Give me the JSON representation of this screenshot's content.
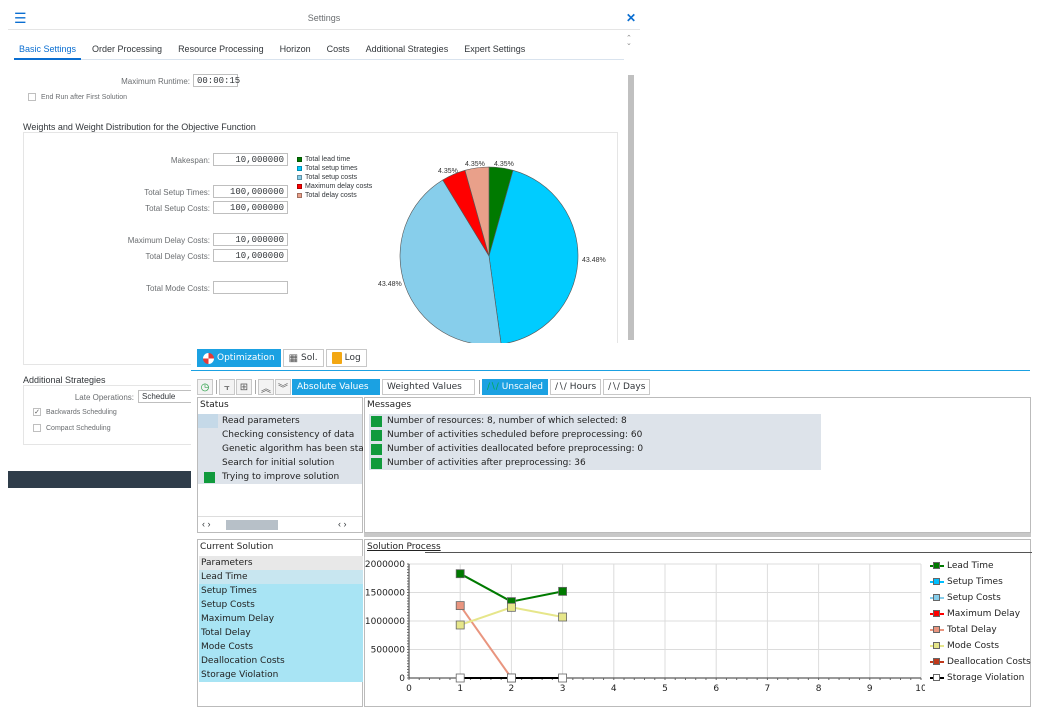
{
  "settings": {
    "title": "Settings",
    "menu_icon": "☰",
    "close_icon": "✕",
    "tabs": [
      {
        "label": "Basic Settings",
        "active": true
      },
      {
        "label": "Order Processing"
      },
      {
        "label": "Resource Processing"
      },
      {
        "label": "Horizon"
      },
      {
        "label": "Costs"
      },
      {
        "label": "Additional Strategies"
      },
      {
        "label": "Expert Settings"
      }
    ],
    "max_runtime_label": "Maximum Runtime:",
    "max_runtime_value": "00:00:15",
    "end_run_label": "End Run after First Solution",
    "end_run_checked": false,
    "weights": {
      "title": "Weights and Weight Distribution for the Objective Function",
      "fields": [
        {
          "label": "Makespan:",
          "value": "10,000000"
        },
        {
          "label": "Total Setup Times:",
          "value": "100,000000"
        },
        {
          "label": "Total Setup Costs:",
          "value": "100,000000"
        },
        {
          "label": "Maximum Delay Costs:",
          "value": "10,000000"
        },
        {
          "label": "Total Delay Costs:",
          "value": "10,000000"
        },
        {
          "label": "Total Mode Costs:",
          "value": ""
        }
      ]
    },
    "additional": {
      "title": "Additional Strategies",
      "late_ops_label": "Late Operations:",
      "late_ops_value": "Schedule",
      "backwards_label": "Backwards Scheduling",
      "backwards_checked": true,
      "compact_label": "Compact Scheduling",
      "compact_checked": false
    }
  },
  "pie_chart": {
    "type": "pie",
    "legend": [
      {
        "label": "Total lead time",
        "color": "#007a00"
      },
      {
        "label": "Total setup times",
        "color": "#00ccff"
      },
      {
        "label": "Total setup costs",
        "color": "#87ceeb"
      },
      {
        "label": "Maximum delay costs",
        "color": "#ff0000"
      },
      {
        "label": "Total delay costs",
        "color": "#e9a08a"
      }
    ],
    "slices": [
      {
        "label": "Total lead time",
        "value": 4.35,
        "text": "4.35%"
      },
      {
        "label": "Total setup times",
        "value": 43.48,
        "text": "43.48%"
      },
      {
        "label": "Total setup costs",
        "value": 43.48,
        "text": "43.48%"
      },
      {
        "label": "Maximum delay costs",
        "value": 4.35,
        "text": "4.35%"
      },
      {
        "label": "Total delay costs",
        "value": 4.35,
        "text": "4.35%"
      }
    ]
  },
  "optimizer": {
    "tabs": [
      {
        "label": "Optimization",
        "active": true
      },
      {
        "label": "Sol."
      },
      {
        "label": "Log"
      }
    ],
    "toolbar": {
      "value_modes": [
        {
          "label": "Absolute Values",
          "on": true
        },
        {
          "label": "Weighted Values",
          "on": false
        }
      ],
      "scales": [
        {
          "label": "Unscaled",
          "on": true
        },
        {
          "label": "Hours",
          "on": false
        },
        {
          "label": "Days",
          "on": false
        }
      ]
    },
    "status": {
      "title": "Status",
      "items": [
        {
          "text": "Read parameters",
          "state": "done"
        },
        {
          "text": "Checking consistency of data",
          "state": "none"
        },
        {
          "text": "Genetic algorithm has been started",
          "state": "none"
        },
        {
          "text": "Search for initial solution",
          "state": "none"
        },
        {
          "text": "Trying to improve solution",
          "state": "active"
        }
      ]
    },
    "messages": {
      "title": "Messages",
      "items": [
        "Number of resources: 8, number of which selected: 8",
        "Number of activities scheduled before preprocessing: 60",
        "Number of activities deallocated before preprocessing: 0",
        "Number of activities after preprocessing: 36"
      ]
    },
    "current_solution": {
      "title": "Current Solution",
      "header": "Parameters",
      "rows": [
        "Lead Time",
        "Setup Times",
        "Setup Costs",
        "Maximum Delay",
        "Total Delay",
        "Mode Costs",
        "Deallocation Costs",
        "Storage Violation"
      ]
    },
    "solution_process_title": "Solution Process"
  },
  "chart_data": {
    "type": "line",
    "title": "Solution Process",
    "xlabel": "",
    "ylabel": "",
    "xlim": [
      0,
      10
    ],
    "ylim": [
      0,
      2000000
    ],
    "x_ticks": [
      0,
      1,
      2,
      3,
      4,
      5,
      6,
      7,
      8,
      9,
      10
    ],
    "y_ticks": [
      0,
      500000,
      1000000,
      1500000,
      2000000
    ],
    "grid": true,
    "legend_position": "right",
    "series": [
      {
        "name": "Lead Time",
        "color": "#007a00",
        "x": [
          1,
          2,
          3
        ],
        "values": [
          1830000,
          1340000,
          1520000
        ]
      },
      {
        "name": "Setup Times",
        "color": "#00bfff",
        "x": [],
        "values": []
      },
      {
        "name": "Setup Costs",
        "color": "#87ceeb",
        "x": [],
        "values": []
      },
      {
        "name": "Maximum Delay",
        "color": "#ff0000",
        "x": [],
        "values": []
      },
      {
        "name": "Total Delay",
        "color": "#e9957f",
        "x": [
          1,
          2
        ],
        "values": [
          1270000,
          0
        ]
      },
      {
        "name": "Mode Costs",
        "color": "#e6e68a",
        "x": [
          1,
          2,
          3
        ],
        "values": [
          930000,
          1240000,
          1070000
        ]
      },
      {
        "name": "Deallocation Costs",
        "color": "#c0391b",
        "x": [],
        "values": []
      },
      {
        "name": "Storage Violation",
        "color": "#000000",
        "x": [
          1,
          2,
          3
        ],
        "values": [
          0,
          0,
          0
        ]
      }
    ]
  }
}
